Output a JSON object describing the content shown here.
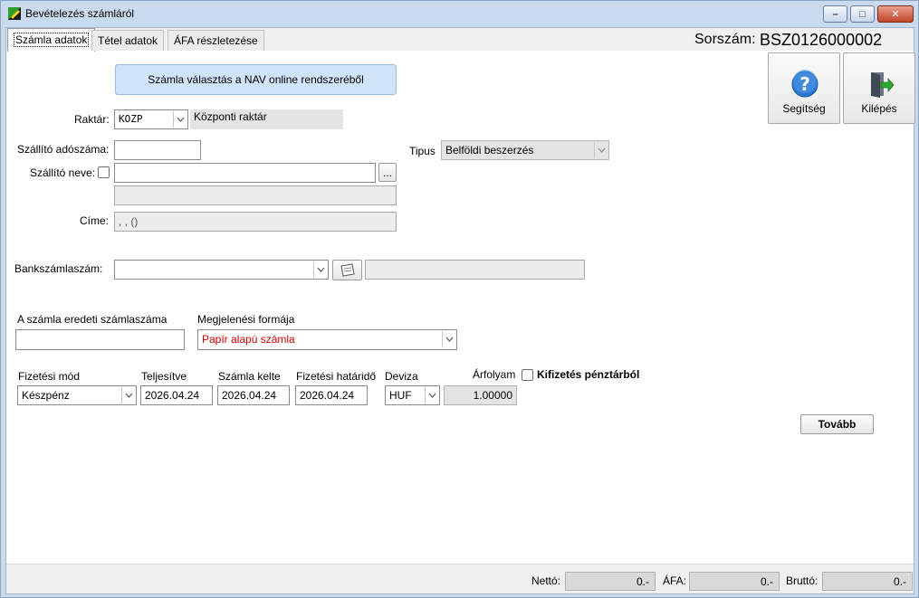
{
  "window": {
    "title": "Bevételezés számláról",
    "minimize": "–",
    "maximize": "□",
    "close": "✕"
  },
  "tabs": [
    "Számla adatok",
    "Tétel adatok",
    "ÁFA részletezése"
  ],
  "header": {
    "sorszam_label": "Sorszám:",
    "sorszam_value": "BSZ0126000002"
  },
  "nav_button": "Számla választás a NAV online rendszeréből",
  "actions": {
    "help": "Segítség",
    "exit": "Kilépés"
  },
  "form": {
    "raktar_label": "Raktár:",
    "raktar_code": "KOZP",
    "raktar_name": "Központi raktár",
    "szallito_adoszama_label": "Szállító adószáma:",
    "szallito_adoszama_value": "",
    "tipus_label": "Tipus",
    "tipus_value": "Belföldi beszerzés",
    "szallito_neve_label": "Szállító neve:",
    "szallito_neve_value": "",
    "browse_button": "...",
    "szallito_extra_value": "",
    "cime_label": "Címe:",
    "cime_value": ", ,  ()",
    "bankszamla_label": "Bankszámlaszám:",
    "bankszamla_value": "",
    "bankszamla_extra": "",
    "eredeti_szamlaszam_label": "A számla eredeti számlaszáma",
    "eredeti_szamlaszam_value": "",
    "megjelenesi_forma_label": "Megjelenési formája",
    "megjelenesi_forma_value": "Papír alapú számla",
    "fizetesi_mod_label": "Fizetési mód",
    "fizetesi_mod_value": "Készpénz",
    "teljesitve_label": "Teljesítve",
    "teljesitve_value": "2026.04.24",
    "szamla_kelte_label": "Számla kelte",
    "szamla_kelte_value": "2026.04.24",
    "fizetesi_hatarido_label": "Fizetési határidő",
    "fizetesi_hatarido_value": "2026.04.24",
    "deviza_label": "Deviza",
    "deviza_value": "HUF",
    "arfolyam_label": "Árfolyam",
    "arfolyam_value": "1.00000",
    "kifizetes_label": "Kifizetés pénztárból",
    "tovabb_button": "Tovább"
  },
  "totals": {
    "netto_label": "Nettó:",
    "netto_value": "0.-",
    "afa_label": "ÁFA:",
    "afa_value": "0.-",
    "brutto_label": "Bruttó:",
    "brutto_value": "0.-"
  },
  "colors": {
    "accent_red": "#cc0000",
    "nav_button_bg": "#cfe4f8",
    "window_frame": "#c9d9ee"
  }
}
